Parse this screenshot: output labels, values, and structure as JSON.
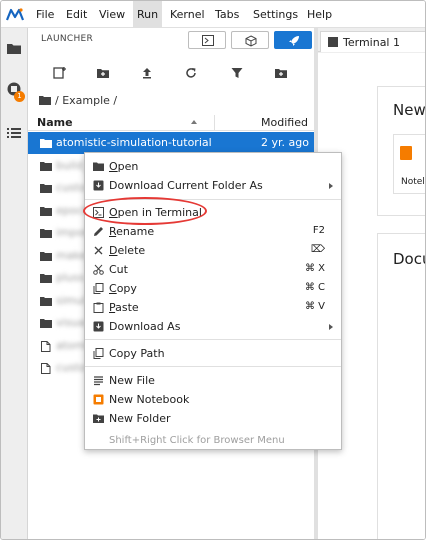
{
  "menubar": {
    "items": [
      "File",
      "Edit",
      "View",
      "Run",
      "Kernel",
      "Tabs",
      "Settings",
      "Help"
    ],
    "active": "Run"
  },
  "activity": {
    "badge_count": "1",
    "icons": [
      "folder-icon",
      "running-sessions-icon",
      "table-of-contents-icon"
    ]
  },
  "browser": {
    "title": "LAUNCHER",
    "toolbar_icons": [
      "new-launcher-icon",
      "new-folder-icon",
      "upload-icon",
      "refresh-icon",
      "filter-icon",
      "new-folder-plus-icon"
    ],
    "breadcrumb": "/ Example /",
    "columns": {
      "name": "Name",
      "modified": "Modified"
    },
    "files": [
      {
        "name": "atomistic-simulation-tutorial",
        "modified": "2 yr. ago",
        "type": "folder",
        "selected": true
      },
      {
        "name": "build_",
        "modified": "",
        "type": "folder",
        "blurred": true
      },
      {
        "name": "custo",
        "modified": "",
        "type": "folder",
        "blurred": true
      },
      {
        "name": "epoch",
        "modified": "",
        "type": "folder",
        "blurred": true
      },
      {
        "name": "impor",
        "modified": "",
        "type": "folder",
        "blurred": true
      },
      {
        "name": "make_",
        "modified": "",
        "type": "folder",
        "blurred": true
      },
      {
        "name": "pluss",
        "modified": "",
        "type": "folder",
        "blurred": true
      },
      {
        "name": "simul",
        "modified": "",
        "type": "folder",
        "blurred": true
      },
      {
        "name": "visua",
        "modified": "",
        "type": "folder",
        "blurred": true
      },
      {
        "name": "atomi",
        "modified": "",
        "type": "file",
        "blurred": true
      },
      {
        "name": "custo",
        "modified": "",
        "type": "file",
        "blurred": true
      }
    ]
  },
  "main": {
    "tab_label": "Terminal 1",
    "section_new": "New",
    "tile_label": "Notel",
    "section_docs": "Docu"
  },
  "context_menu": {
    "items": [
      {
        "label": "Open",
        "icon": "folder-icon",
        "shortcut": ""
      },
      {
        "label": "Download Current Folder As",
        "icon": "download-icon",
        "shortcut": "",
        "submenu": true
      },
      {
        "label": "Open in Terminal",
        "icon": "terminal-icon",
        "shortcut": "",
        "highlighted": true
      },
      {
        "label": "Rename",
        "icon": "pencil-icon",
        "shortcut": "F2"
      },
      {
        "label": "Delete",
        "icon": "close-icon",
        "shortcut": "⌦"
      },
      {
        "label": "Cut",
        "icon": "scissors-icon",
        "shortcut": "⌘ X"
      },
      {
        "label": "Copy",
        "icon": "copy-icon",
        "shortcut": "⌘ C"
      },
      {
        "label": "Paste",
        "icon": "paste-icon",
        "shortcut": "⌘ V"
      },
      {
        "label": "Download As",
        "icon": "download-icon",
        "shortcut": "",
        "submenu": true
      },
      {
        "label": "Copy Path",
        "icon": "copy-icon",
        "shortcut": ""
      },
      {
        "label": "New File",
        "icon": "text-file-icon",
        "shortcut": ""
      },
      {
        "label": "New Notebook",
        "icon": "notebook-icon",
        "shortcut": ""
      },
      {
        "label": "New Folder",
        "icon": "new-folder-icon",
        "shortcut": ""
      }
    ],
    "hint": "Shift+Right Click for Browser Menu"
  },
  "colors": {
    "accent": "#1976d2",
    "highlight_ring": "#e53935",
    "notebook_orange": "#f57c00",
    "badge": "#f57c00"
  }
}
